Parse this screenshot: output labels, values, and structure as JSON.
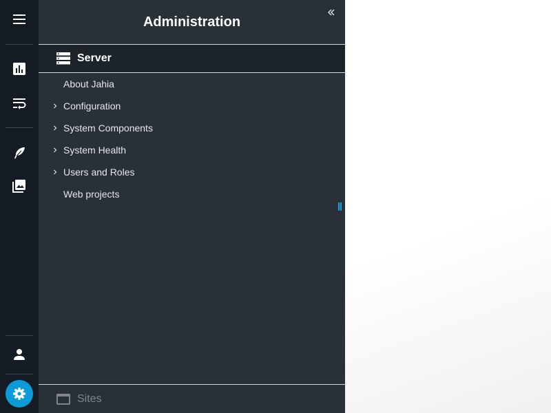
{
  "panel": {
    "title": "Administration",
    "section": {
      "label": "Server",
      "icon": "server-icon"
    },
    "items": [
      {
        "label": "About Jahia",
        "expandable": false
      },
      {
        "label": "Configuration",
        "expandable": true
      },
      {
        "label": "System Components",
        "expandable": true
      },
      {
        "label": "System Health",
        "expandable": true
      },
      {
        "label": "Users and Roles",
        "expandable": true
      },
      {
        "label": "Web projects",
        "expandable": false
      }
    ],
    "sites": {
      "label": "Sites",
      "icon": "browser-window-icon"
    }
  },
  "rail": {
    "top_icons": [
      "menu-icon"
    ],
    "group1_icons": [
      "bar-chart-icon",
      "wrap-text-icon"
    ],
    "group2_icons": [
      "feather-icon",
      "image-library-icon"
    ],
    "bottom_icons": [
      "user-icon",
      "gear-icon"
    ]
  },
  "colors": {
    "rail_bg": "#141b22",
    "panel_bg": "#293038",
    "section_bg": "#1c2329",
    "accent": "#0d9bd8",
    "text": "#e6e8ea",
    "muted": "#80868c"
  }
}
